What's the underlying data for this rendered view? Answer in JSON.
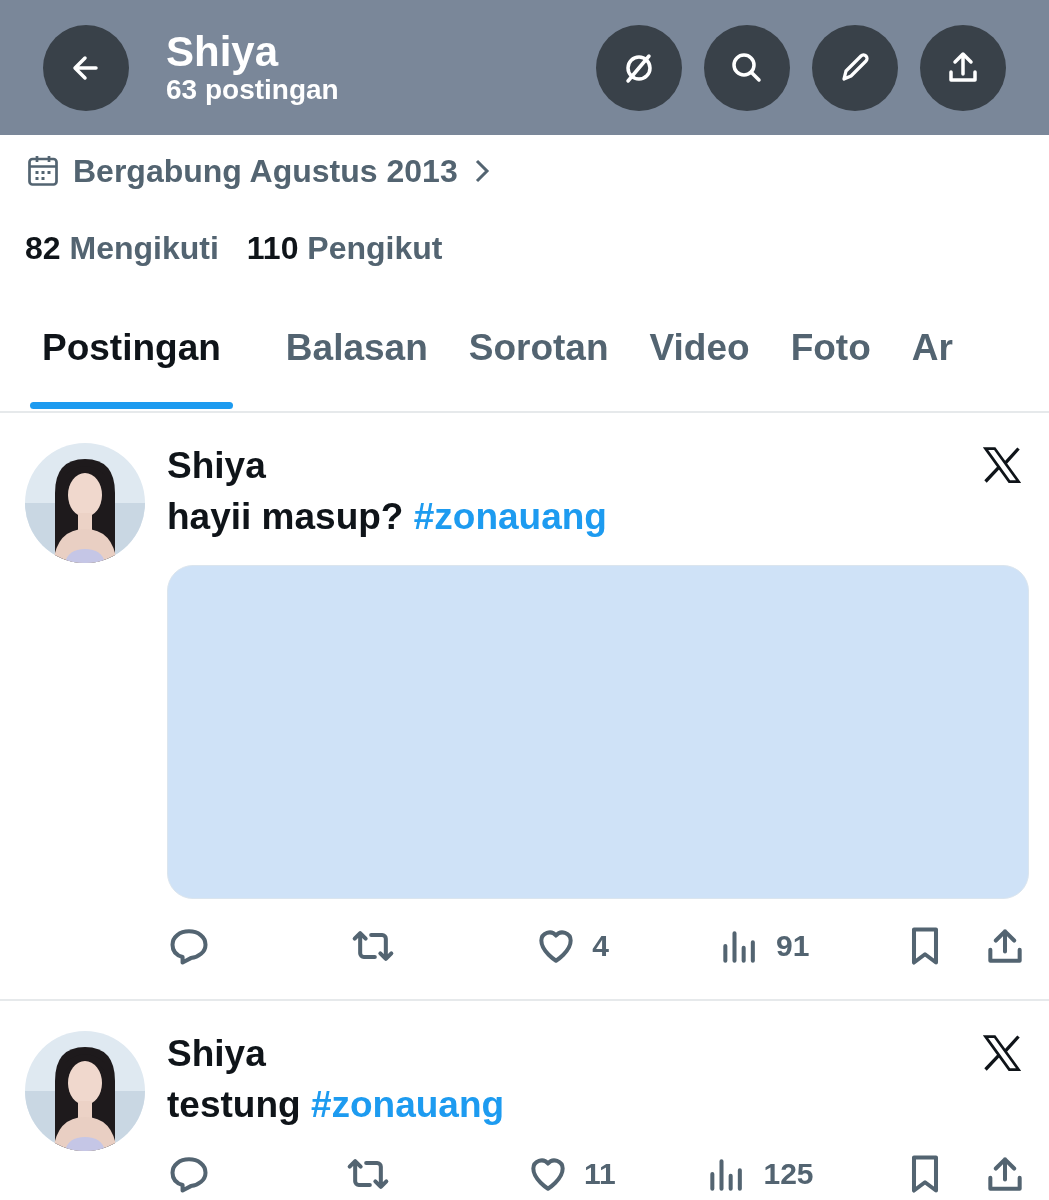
{
  "header": {
    "name": "Shiya",
    "post_count": "63 postingan"
  },
  "joined": "Bergabung Agustus 2013",
  "follow": [
    {
      "count": "82",
      "label": "Mengikuti"
    },
    {
      "count": "110",
      "label": "Pengikut"
    }
  ],
  "tabs": [
    {
      "label": "Postingan",
      "selected": true
    },
    {
      "label": "Balasan",
      "selected": false
    },
    {
      "label": "Sorotan",
      "selected": false
    },
    {
      "label": "Video",
      "selected": false
    },
    {
      "label": "Foto",
      "selected": false
    },
    {
      "label": "Ar",
      "selected": false
    }
  ],
  "posts": [
    {
      "author": "Shiya",
      "text": "hayii masup?",
      "hashtag": "#zonauang",
      "has_media": true,
      "likes": "4",
      "views": "91"
    },
    {
      "author": "Shiya",
      "text": "testung",
      "hashtag": "#zonauang",
      "has_media": false,
      "likes": "11",
      "views": "125"
    }
  ]
}
